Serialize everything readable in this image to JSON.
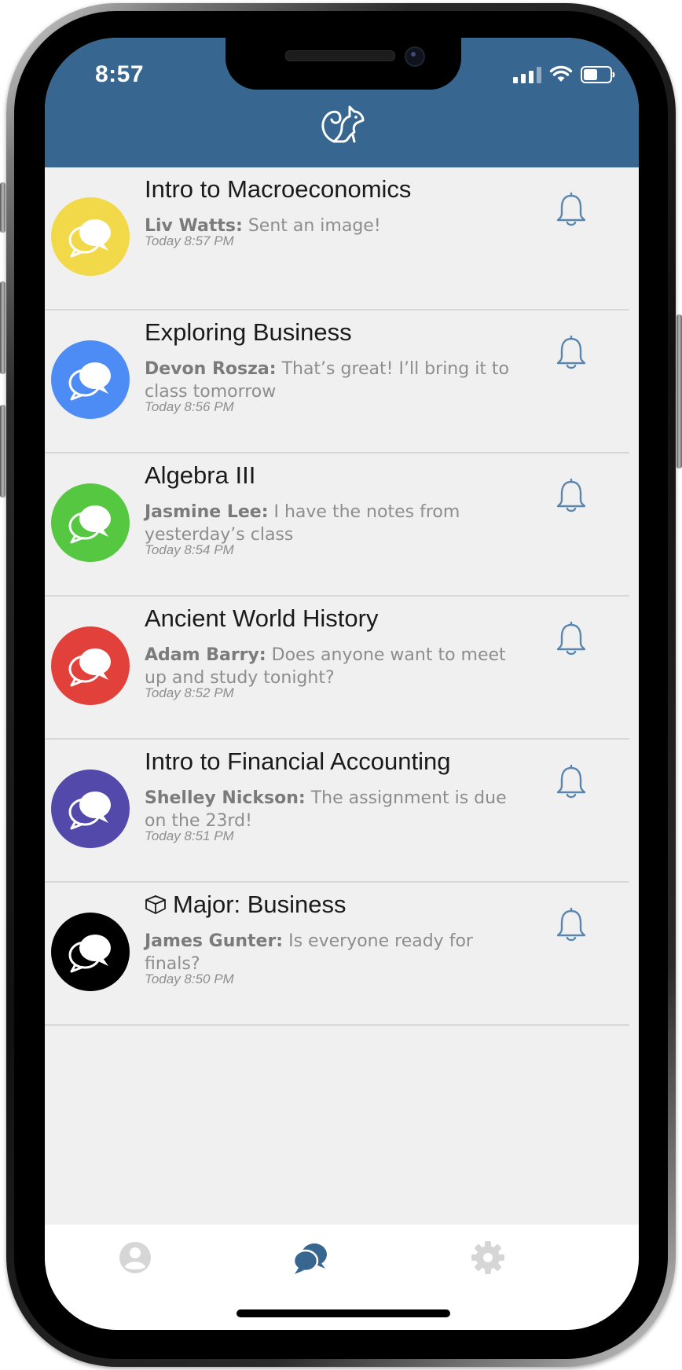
{
  "status_bar": {
    "time": "8:57"
  },
  "app": {
    "logo": "squirrel-logo-icon",
    "header_color": "#376790"
  },
  "chats": [
    {
      "title": "Intro to Macroeconomics",
      "sender": "Liv Watts:",
      "message": "Sent an image!",
      "time": "Today 8:57 PM",
      "color": "#f2d94a",
      "has_major_icon": false
    },
    {
      "title": "Exploring Business",
      "sender": "Devon Rosza:",
      "message": "That’s great! I’ll bring it to class tomorrow",
      "time": "Today 8:56 PM",
      "color": "#4d8bf5",
      "has_major_icon": false
    },
    {
      "title": "Algebra III",
      "sender": "Jasmine Lee:",
      "message": "I have the notes from yesterday’s class",
      "time": "Today 8:54 PM",
      "color": "#55c741",
      "has_major_icon": false
    },
    {
      "title": "Ancient World History",
      "sender": "Adam Barry:",
      "message": "Does anyone want to meet up and study tonight?",
      "time": "Today 8:52 PM",
      "color": "#e2403b",
      "has_major_icon": false
    },
    {
      "title": "Intro to Financial Accounting",
      "sender": "Shelley Nickson:",
      "message": "The assignment is due on the 23rd!",
      "time": "Today 8:51 PM",
      "color": "#5349ab",
      "has_major_icon": false
    },
    {
      "title": "Major: Business",
      "sender": "James Gunter:",
      "message": "Is everyone ready for finals?",
      "time": "Today 8:50 PM",
      "color": "#000000",
      "has_major_icon": true
    }
  ],
  "tab_bar": {
    "items": [
      {
        "icon": "profile-icon",
        "active": false
      },
      {
        "icon": "chat-bubbles-icon",
        "active": true
      },
      {
        "icon": "gear-icon",
        "active": false
      }
    ],
    "active_color": "#376790",
    "inactive_color": "#d6d6d6"
  }
}
